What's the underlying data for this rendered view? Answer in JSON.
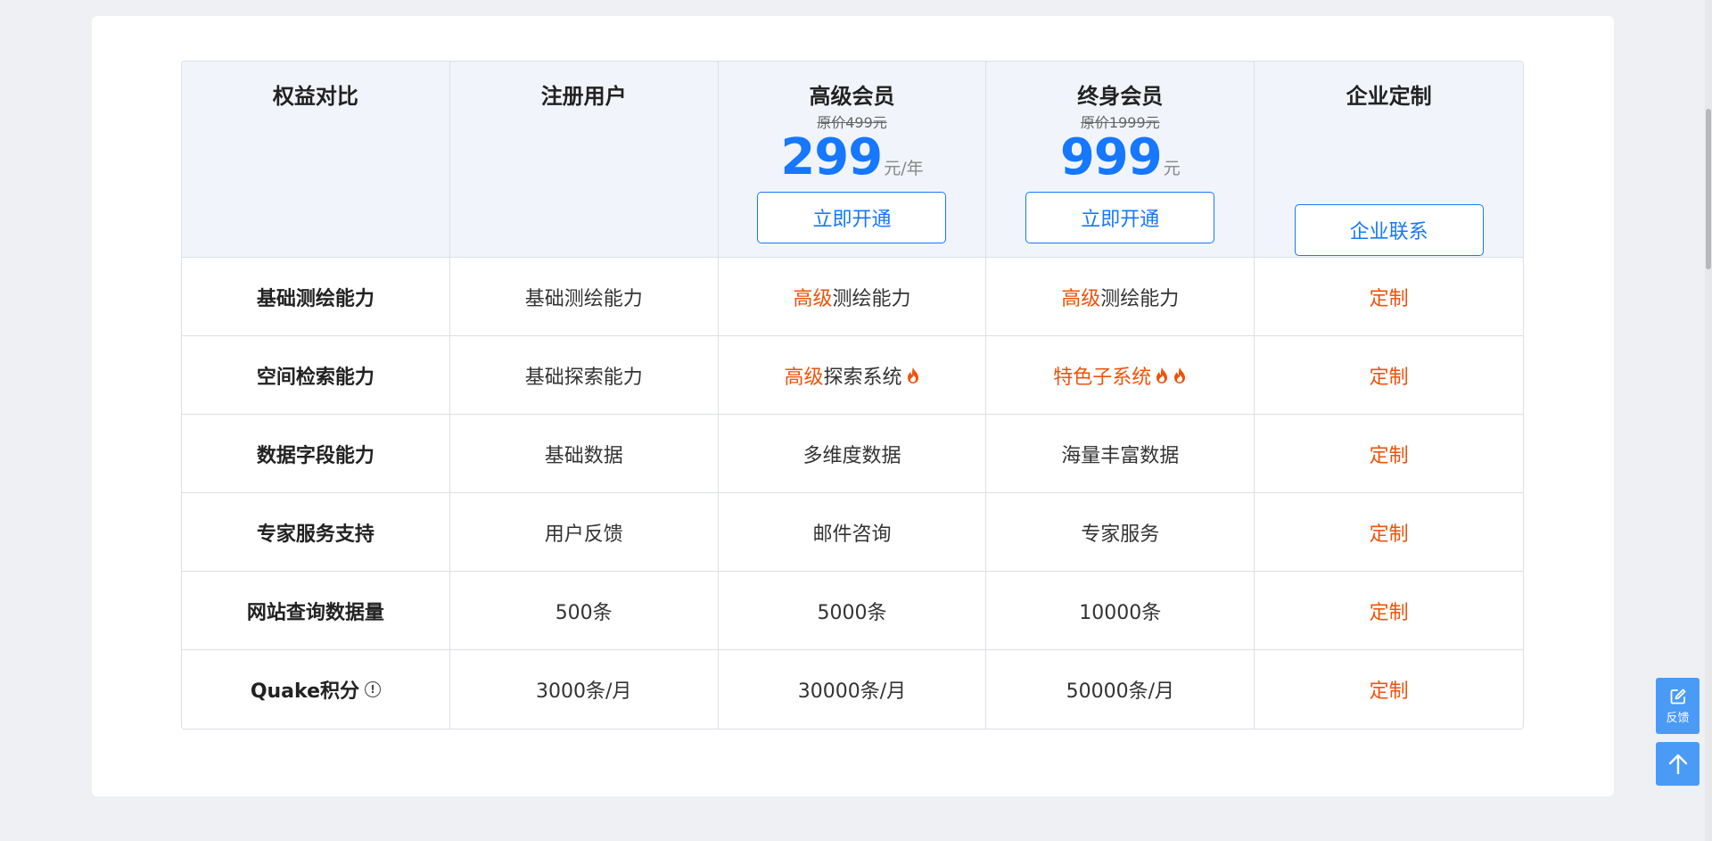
{
  "header": {
    "col0": "权益对比",
    "col1": "注册用户",
    "col2": {
      "title": "高级会员",
      "orig_price": "原价499元",
      "price": "299",
      "unit": "元/年",
      "button": "立即开通"
    },
    "col3": {
      "title": "终身会员",
      "orig_price": "原价1999元",
      "price": "999",
      "unit": "元",
      "button": "立即开通"
    },
    "col4": {
      "title": "企业定制",
      "button": "企业联系"
    }
  },
  "rows": [
    {
      "label": "基础测绘能力",
      "free": "基础测绘能力",
      "premium_hl": "高级",
      "premium_rest": "测绘能力",
      "lifetime_hl": "高级",
      "lifetime_rest": "测绘能力",
      "enterprise": "定制"
    },
    {
      "label": "空间检索能力",
      "free": "基础探索能力",
      "premium_hl": "高级",
      "premium_rest": "探索系统",
      "lifetime_hl": "特色子系统",
      "enterprise": "定制"
    },
    {
      "label": "数据字段能力",
      "free": "基础数据",
      "premium": "多维度数据",
      "lifetime": "海量丰富数据",
      "enterprise": "定制"
    },
    {
      "label": "专家服务支持",
      "free": "用户反馈",
      "premium": "邮件咨询",
      "lifetime": "专家服务",
      "enterprise": "定制"
    },
    {
      "label": "网站查询数据量",
      "free": "500条",
      "premium": "5000条",
      "lifetime": "10000条",
      "enterprise": "定制"
    },
    {
      "label": "Quake积分",
      "label_icon": "info-icon",
      "free": "3000条/月",
      "premium": "30000条/月",
      "lifetime": "50000条/月",
      "enterprise": "定制"
    }
  ],
  "floating": {
    "feedback_label": "反馈",
    "feedback_icon": "edit-icon",
    "top_icon": "arrow-up-icon"
  },
  "colors": {
    "accent": "#1677ff",
    "highlight": "#f0520a",
    "header_bg": "#f1f5fb",
    "float_bg": "#4a9bf6"
  }
}
